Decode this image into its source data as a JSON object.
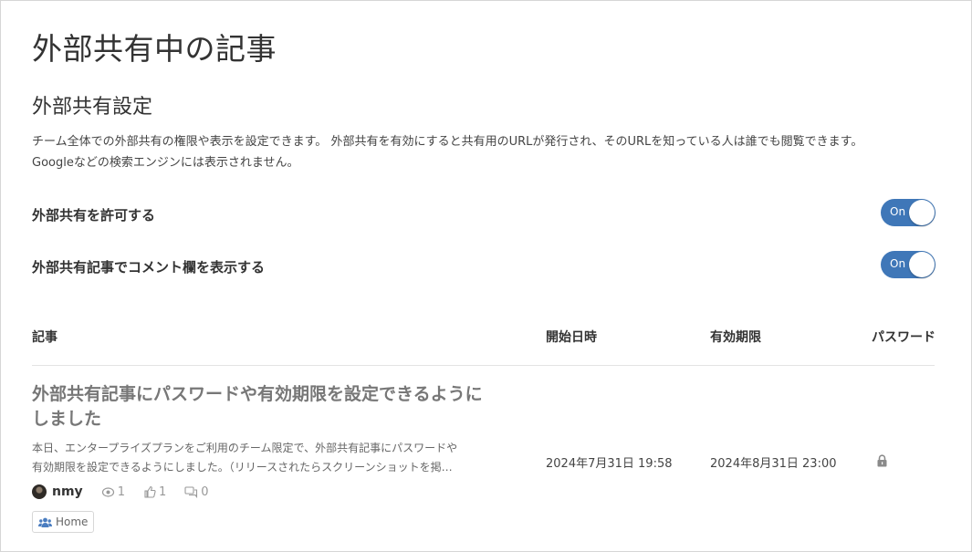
{
  "page": {
    "title": "外部共有中の記事"
  },
  "settings": {
    "section_title": "外部共有設定",
    "description_line1": "チーム全体での外部共有の権限や表示を設定できます。 外部共有を有効にすると共有用のURLが発行され、そのURLを知っている人は誰でも閲覧できます。",
    "description_line2": "Googleなどの検索エンジンには表示されません。",
    "allow_sharing": {
      "label": "外部共有を許可する",
      "state": "On"
    },
    "show_comments": {
      "label": "外部共有記事でコメント欄を表示する",
      "state": "On"
    }
  },
  "table": {
    "headers": {
      "article": "記事",
      "start": "開始日時",
      "expiry": "有効期限",
      "password": "パスワード"
    },
    "rows": [
      {
        "title": "外部共有記事にパスワードや有効期限を設定できるようにしました",
        "body_line1": "本日、エンタープライズプランをご利用のチーム限定で、外部共有記事にパスワードや",
        "body_line2": "有効期限を設定できるようにしました。（リリースされたらスクリーンショットを掲…",
        "author": "nmy",
        "views": "1",
        "likes": "1",
        "comments": "0",
        "tag": "Home",
        "start": "2024年7月31日 19:58",
        "expiry": "2024年8月31日 23:00",
        "password_icon": "lock-icon"
      }
    ]
  },
  "colors": {
    "toggle_on": "#3f77b8",
    "muted_title": "#777777"
  }
}
